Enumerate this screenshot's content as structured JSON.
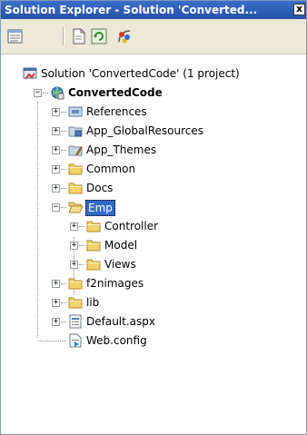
{
  "window": {
    "title": "Solution Explorer - Solution 'Converted...",
    "close_label": "x"
  },
  "toolbar": {
    "buttons": [
      "properties-icon",
      "show-all-files-icon",
      "refresh-icon",
      "class-diagram-icon"
    ]
  },
  "tree": {
    "solution": {
      "label": "Solution 'ConvertedCode' (1 project)"
    },
    "project": {
      "label": "ConvertedCode"
    },
    "items": [
      {
        "label": "References",
        "icon": "references-icon"
      },
      {
        "label": "App_GlobalResources",
        "icon": "resources-folder-icon"
      },
      {
        "label": "App_Themes",
        "icon": "themes-folder-icon"
      },
      {
        "label": "Common",
        "icon": "folder-icon"
      },
      {
        "label": "Docs",
        "icon": "folder-icon"
      },
      {
        "label": "Emp",
        "icon": "open-folder-icon",
        "selected": true
      },
      {
        "label": "Controller",
        "icon": "folder-icon"
      },
      {
        "label": "Model",
        "icon": "folder-icon"
      },
      {
        "label": "Views",
        "icon": "folder-icon"
      },
      {
        "label": "f2nimages",
        "icon": "folder-icon"
      },
      {
        "label": "lib",
        "icon": "folder-icon"
      },
      {
        "label": "Default.aspx",
        "icon": "aspx-file-icon"
      },
      {
        "label": "Web.config",
        "icon": "config-file-icon"
      }
    ]
  },
  "colors": {
    "title_bar": "#2b5cb8",
    "selection": "#316ac5",
    "folder": "#f4d26b"
  }
}
